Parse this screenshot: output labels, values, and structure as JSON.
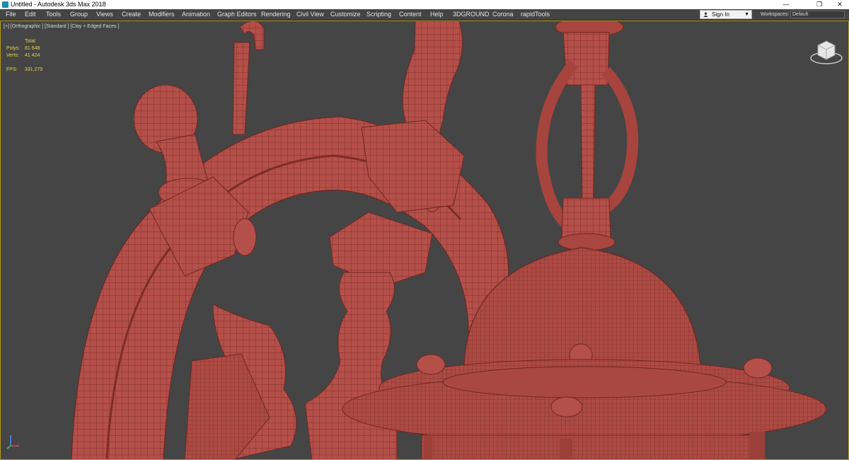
{
  "window": {
    "title": "Untitled - Autodesk 3ds Max 2018",
    "controls": [
      "—",
      "❐",
      "✕"
    ]
  },
  "menu": [
    "File",
    "Edit",
    "Tools",
    "Group",
    "Views",
    "Create",
    "Modifiers",
    "Animation",
    "Graph Editors",
    "Rendering",
    "Civil View",
    "Customize",
    "Scripting",
    "Content",
    "Help",
    "3DGROUND",
    "Corona",
    "rapidTools"
  ],
  "account": {
    "sign_in_label": "Sign In"
  },
  "workspace": {
    "label": "Workspaces:",
    "value": "Default"
  },
  "viewport": {
    "label": "[+] [Orthographic ] [Standard ] [Clay + Edged Faces ]",
    "stats": {
      "header": "Total",
      "rows": [
        {
          "label": "Polys:",
          "value": "81 648"
        },
        {
          "label": "Verts:",
          "value": "41 424"
        }
      ],
      "fps_label": "FPS:",
      "fps_value": "331,279"
    },
    "border_color": "#b59a18",
    "clay_color": "#b44f49"
  },
  "icons": [
    "app-icon",
    "user-icon",
    "dropdown-arrow-icon",
    "viewcube-icon",
    "axis-gizmo-icon"
  ]
}
